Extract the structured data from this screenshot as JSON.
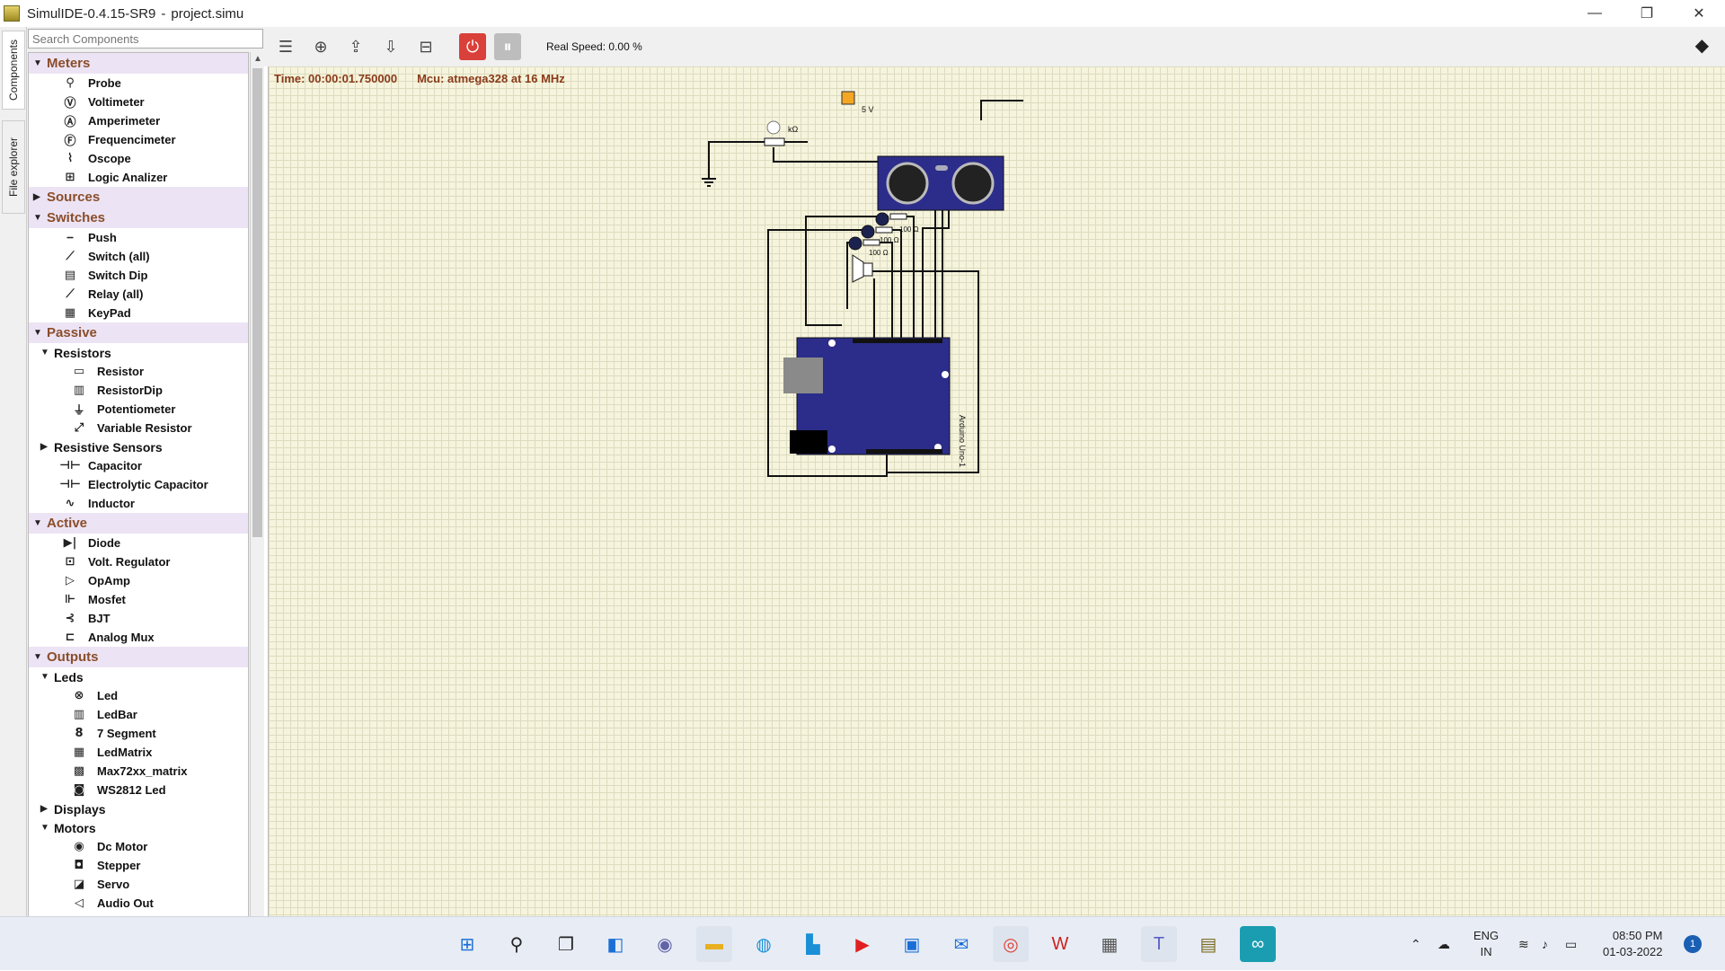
{
  "window": {
    "app": "SimulIDE-0.4.15-SR9",
    "separator": "-",
    "file": "project.simu",
    "minimize": "—",
    "maximize": "❐",
    "close": "✕"
  },
  "side_tabs": {
    "components": "Components",
    "file_explorer": "File explorer"
  },
  "search": {
    "placeholder": "Search Components"
  },
  "tree": {
    "meters": {
      "label": "Meters",
      "items": [
        "Probe",
        "Voltimeter",
        "Amperimeter",
        "Frequencimeter",
        "Oscope",
        "Logic Analizer"
      ]
    },
    "sources": {
      "label": "Sources"
    },
    "switches": {
      "label": "Switches",
      "items": [
        "Push",
        "Switch (all)",
        "Switch Dip",
        "Relay (all)",
        "KeyPad"
      ]
    },
    "passive": {
      "label": "Passive",
      "resistors": {
        "label": "Resistors",
        "items": [
          "Resistor",
          "ResistorDip",
          "Potentiometer",
          "Variable Resistor"
        ]
      },
      "resistive_sensors": {
        "label": "Resistive Sensors"
      },
      "items": [
        "Capacitor",
        "Electrolytic Capacitor",
        "Inductor"
      ]
    },
    "active": {
      "label": "Active",
      "items": [
        "Diode",
        "Volt. Regulator",
        "OpAmp",
        "Mosfet",
        "BJT",
        "Analog Mux"
      ]
    },
    "outputs": {
      "label": "Outputs",
      "leds": {
        "label": "Leds",
        "items": [
          "Led",
          "LedBar",
          "7 Segment",
          "LedMatrix",
          "Max72xx_matrix",
          "WS2812 Led"
        ]
      },
      "displays": {
        "label": "Displays"
      },
      "motors": {
        "label": "Motors",
        "items": [
          "Dc Motor",
          "Stepper",
          "Servo",
          "Audio Out"
        ]
      }
    }
  },
  "toolbar": {
    "real_speed": "Real Speed: 0.00 %"
  },
  "canvas": {
    "time": "Time: 00:00:01.750000",
    "mcu": "Mcu: atmega328 at 16 MHz",
    "labels": {
      "supply": "5 V",
      "pot_unit": "kΩ",
      "r1": "100 Ω",
      "r2": "100 Ω",
      "r3": "100 Ω",
      "arduino": "Arduino Uno-1"
    }
  },
  "taskbar": {
    "lang_top": "ENG",
    "lang_bottom": "IN",
    "time": "08:50 PM",
    "date": "01-03-2022",
    "notifications": "1"
  }
}
